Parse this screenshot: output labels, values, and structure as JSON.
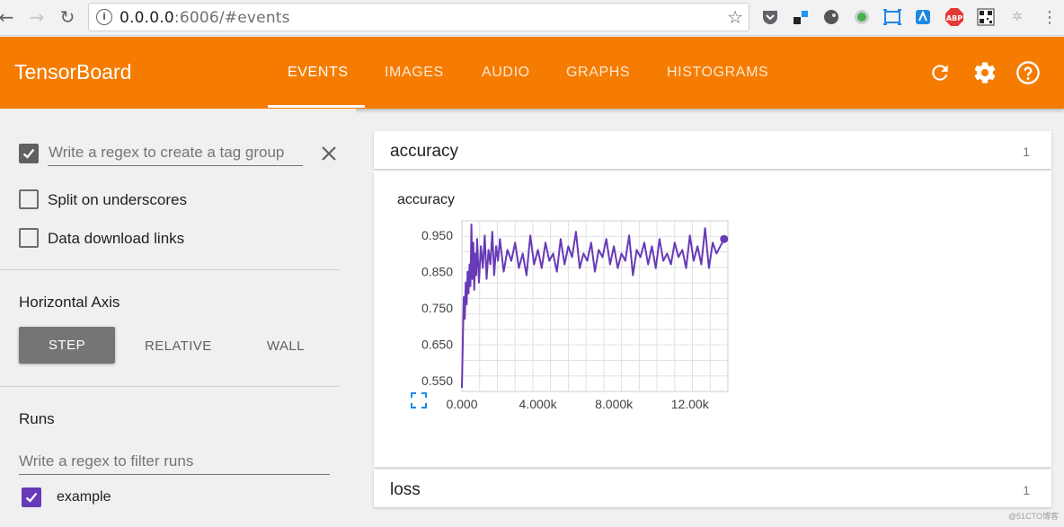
{
  "browser": {
    "url_host": "0.0.0.0",
    "url_rest": ":6006/#events"
  },
  "header": {
    "title": "TensorBoard",
    "tabs": [
      {
        "label": "EVENTS",
        "active": true
      },
      {
        "label": "IMAGES",
        "active": false
      },
      {
        "label": "AUDIO",
        "active": false
      },
      {
        "label": "GRAPHS",
        "active": false
      },
      {
        "label": "HISTOGRAMS",
        "active": false
      }
    ],
    "accent": "#f57c00"
  },
  "sidebar": {
    "tag_group_placeholder": "Write a regex to create a tag group",
    "split_label": "Split on underscores",
    "download_label": "Data download links",
    "horizontal_axis_title": "Horizontal Axis",
    "axis_options": [
      "STEP",
      "RELATIVE",
      "WALL"
    ],
    "axis_selected": "STEP",
    "runs_title": "Runs",
    "runs_placeholder": "Write a regex to filter runs",
    "runs": [
      {
        "name": "example",
        "checked": true,
        "color": "#673ab7"
      }
    ]
  },
  "main": {
    "cards": [
      {
        "title": "accuracy",
        "count": "1"
      },
      {
        "title": "loss",
        "count": "1"
      }
    ],
    "watermark": "@51CTO博客"
  },
  "chart_data": {
    "type": "line",
    "title": "accuracy",
    "xlabel": "",
    "ylabel": "",
    "x_ticks": [
      "0.000",
      "4.000k",
      "8.000k",
      "12.00k"
    ],
    "y_ticks": [
      "0.550",
      "0.650",
      "0.750",
      "0.850",
      "0.950"
    ],
    "xlim": [
      0,
      14000
    ],
    "ylim": [
      0.52,
      0.99
    ],
    "grid": true,
    "series": [
      {
        "name": "example",
        "color": "#673ab7",
        "x": [
          0,
          50,
          100,
          150,
          200,
          250,
          300,
          350,
          400,
          450,
          500,
          550,
          600,
          650,
          700,
          750,
          800,
          900,
          1000,
          1100,
          1200,
          1300,
          1400,
          1500,
          1600,
          1700,
          1800,
          1900,
          2000,
          2200,
          2400,
          2600,
          2800,
          3000,
          3200,
          3400,
          3600,
          3800,
          4000,
          4200,
          4400,
          4600,
          4800,
          5000,
          5200,
          5400,
          5600,
          5800,
          6000,
          6200,
          6400,
          6600,
          6800,
          7000,
          7200,
          7400,
          7600,
          7800,
          8000,
          8200,
          8400,
          8600,
          8800,
          9000,
          9200,
          9400,
          9600,
          9800,
          10000,
          10200,
          10400,
          10600,
          10800,
          11000,
          11200,
          11400,
          11600,
          11800,
          12000,
          12200,
          12400,
          12600,
          12800,
          13000,
          13200,
          13400,
          13600,
          13800
        ],
        "y": [
          0.53,
          0.67,
          0.78,
          0.72,
          0.82,
          0.76,
          0.85,
          0.79,
          0.87,
          0.81,
          0.98,
          0.83,
          0.93,
          0.8,
          0.9,
          0.84,
          0.94,
          0.82,
          0.92,
          0.86,
          0.95,
          0.83,
          0.91,
          0.87,
          0.96,
          0.84,
          0.92,
          0.88,
          0.94,
          0.85,
          0.91,
          0.88,
          0.93,
          0.86,
          0.9,
          0.84,
          0.95,
          0.87,
          0.91,
          0.86,
          0.93,
          0.88,
          0.9,
          0.85,
          0.94,
          0.87,
          0.92,
          0.89,
          0.96,
          0.86,
          0.9,
          0.88,
          0.93,
          0.85,
          0.91,
          0.89,
          0.94,
          0.87,
          0.92,
          0.86,
          0.9,
          0.88,
          0.95,
          0.84,
          0.91,
          0.89,
          0.93,
          0.87,
          0.92,
          0.86,
          0.94,
          0.88,
          0.9,
          0.87,
          0.93,
          0.89,
          0.91,
          0.86,
          0.95,
          0.88,
          0.92,
          0.87,
          0.97,
          0.86,
          0.93,
          0.9,
          0.92,
          0.94
        ]
      }
    ]
  }
}
